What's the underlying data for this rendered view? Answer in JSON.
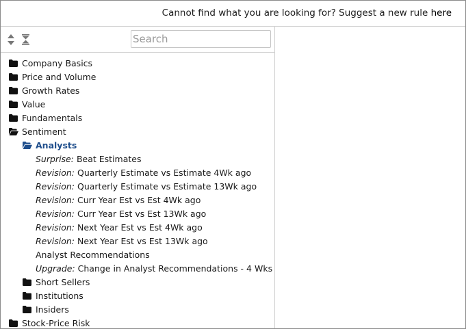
{
  "header": {
    "suggest_text": "Cannot find what you are looking for? Suggest a new rule",
    "suggest_link": "here"
  },
  "toolbar": {
    "sort_icon": "sort-up-down-icon",
    "collapse_icon": "collapse-all-icon",
    "search_placeholder": "Search"
  },
  "tree": {
    "folders": [
      {
        "label": "Company Basics",
        "expanded": false
      },
      {
        "label": "Price and Volume",
        "expanded": false
      },
      {
        "label": "Growth Rates",
        "expanded": false
      },
      {
        "label": "Value",
        "expanded": false
      },
      {
        "label": "Fundamentals",
        "expanded": false
      },
      {
        "label": "Sentiment",
        "expanded": true
      }
    ],
    "sentiment_children": [
      {
        "label": "Analysts",
        "expanded": true,
        "active": true
      },
      {
        "label": "Short Sellers",
        "expanded": false
      },
      {
        "label": "Institutions",
        "expanded": false
      },
      {
        "label": "Insiders",
        "expanded": false
      }
    ],
    "analyst_rules": [
      {
        "prefix": "Surprise:",
        "label": "Beat Estimates"
      },
      {
        "prefix": "Revision:",
        "label": "Quarterly Estimate vs Estimate 4Wk ago"
      },
      {
        "prefix": "Revision:",
        "label": "Quarterly Estimate vs Estimate 13Wk ago"
      },
      {
        "prefix": "Revision:",
        "label": "Curr Year Est vs Est 4Wk ago"
      },
      {
        "prefix": "Revision:",
        "label": "Curr Year Est vs Est 13Wk ago"
      },
      {
        "prefix": "Revision:",
        "label": "Next Year Est vs Est 4Wk ago"
      },
      {
        "prefix": "Revision:",
        "label": "Next Year Est vs Est 13Wk ago"
      },
      {
        "prefix": "",
        "label": "Analyst Recommendations"
      },
      {
        "prefix": "Upgrade:",
        "label": "Change in Analyst Recommendations - 4 Wks"
      }
    ],
    "after_sentiment": [
      {
        "label": "Stock-Price Risk",
        "expanded": false
      }
    ]
  },
  "colors": {
    "active": "#1f4e8c",
    "folder": "#111111",
    "border": "#d0d0d0"
  }
}
